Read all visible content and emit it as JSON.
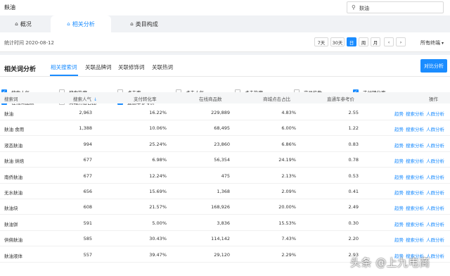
{
  "app": {
    "title": "麸油"
  },
  "search": {
    "value": "麸油"
  },
  "tabs": [
    {
      "label": "概况",
      "active": false
    },
    {
      "label": "相关分析",
      "active": true
    },
    {
      "label": "类目构成",
      "active": false
    }
  ],
  "filter": {
    "stat_time": "统计时间 2020-08-12",
    "periods": [
      "7天",
      "30天",
      "日",
      "周",
      "月"
    ],
    "active_period": "日",
    "terminal": "所有终端"
  },
  "panel": {
    "title": "相关词分析",
    "subtabs": [
      "相关搜索词",
      "关联品牌词",
      "关联修饰词",
      "关联热词"
    ],
    "active_subtab": "相关搜索词",
    "compare_label": "对比分析"
  },
  "checkboxes": [
    {
      "label": "搜索人气",
      "checked": true
    },
    {
      "label": "搜索热度",
      "checked": false
    },
    {
      "label": "点击率",
      "checked": false
    },
    {
      "label": "点击人气",
      "checked": false
    },
    {
      "label": "点击热度",
      "checked": false
    },
    {
      "label": "交易指数",
      "checked": false
    },
    {
      "label": "支付转化率",
      "checked": true
    },
    {
      "label": "在线商品数",
      "checked": true
    },
    {
      "label": "商城点击占比",
      "checked": false
    },
    {
      "label": "直通车参考价",
      "checked": true
    }
  ],
  "table": {
    "columns": [
      "搜索词",
      "搜索人气",
      "支付转化率",
      "在线商品数",
      "商城点击占比",
      "直通车参考价",
      "操作"
    ],
    "ops": [
      "趋势",
      "搜索分析",
      "人群分析"
    ],
    "rows": [
      [
        "麸油",
        "2,963",
        "16.22%",
        "229,889",
        "4.83%",
        "2.55"
      ],
      [
        "麸油 食用",
        "1,388",
        "10.06%",
        "68,495",
        "6.00%",
        "1.22"
      ],
      [
        "液态麸油",
        "994",
        "25.24%",
        "23,860",
        "6.86%",
        "0.83"
      ],
      [
        "麸油 烘焙",
        "677",
        "6.98%",
        "56,354",
        "24.19%",
        "0.78"
      ],
      [
        "南侨麸油",
        "677",
        "12.24%",
        "475",
        "2.13%",
        "0.53"
      ],
      [
        "无水麸油",
        "656",
        "15.69%",
        "1,368",
        "2.09%",
        "0.41"
      ],
      [
        "麸油块",
        "608",
        "21.57%",
        "168,926",
        "20.00%",
        "2.49"
      ],
      [
        "麸油饼",
        "591",
        "5.00%",
        "3,836",
        "15.53%",
        "0.30"
      ],
      [
        "供佛麸油",
        "585",
        "30.43%",
        "114,142",
        "7.43%",
        "2.20"
      ],
      [
        "麸油液体",
        "557",
        "39.47%",
        "29,120",
        "2.29%",
        "2.93"
      ]
    ]
  },
  "watermark": "头条 @上九电商"
}
